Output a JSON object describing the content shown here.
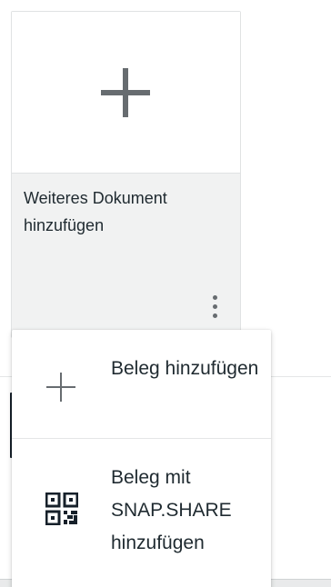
{
  "document_card": {
    "label": "Weiteres Dokument hinzufügen",
    "preview_icon": "plus-icon",
    "menu_icon": "more-vertical-icon"
  },
  "context_menu": {
    "items": [
      {
        "label": "Beleg hinzufügen",
        "icon": "plus-icon"
      },
      {
        "label": "Beleg mit SNAP.SHARE hinzufügen",
        "icon": "qr-code-icon"
      }
    ]
  },
  "colors": {
    "text": "#1f2a30",
    "card_background": "#f1f2f2",
    "icon_gray": "#676c70",
    "qr_icon": "#16202a"
  }
}
